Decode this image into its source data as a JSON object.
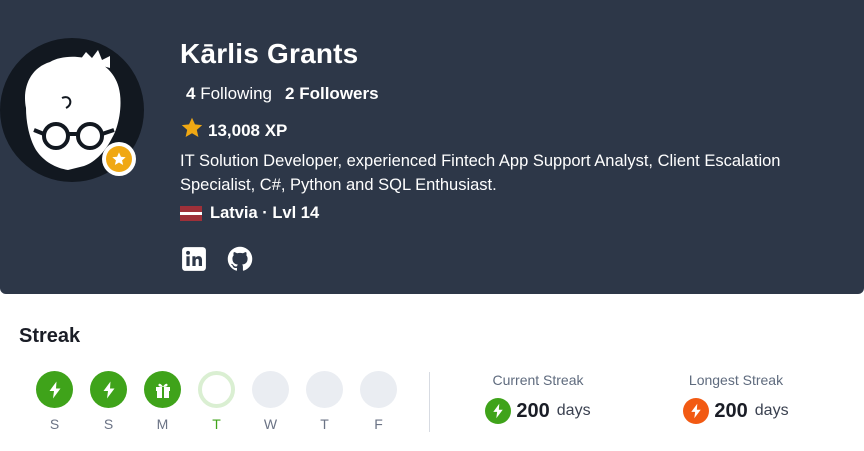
{
  "profile": {
    "name": "Kārlis Grants",
    "following_count": "4",
    "following_label": "Following",
    "followers_count": "2",
    "followers_label": "Followers",
    "xp": "13,008 XP",
    "bio": "IT Solution Developer, experienced Fintech App Support Analyst, Client Escalation Specialist, C#, Python and SQL Enthusiast.",
    "location": "Latvia · Lvl 14",
    "socials": [
      "linkedin-icon",
      "github-icon"
    ]
  },
  "streak": {
    "title": "Streak",
    "days": [
      {
        "label": "S",
        "state": "done",
        "icon": "bolt-icon"
      },
      {
        "label": "S",
        "state": "done",
        "icon": "bolt-icon"
      },
      {
        "label": "M",
        "state": "done",
        "icon": "gift-icon"
      },
      {
        "label": "T",
        "state": "today",
        "icon": ""
      },
      {
        "label": "W",
        "state": "future",
        "icon": ""
      },
      {
        "label": "T",
        "state": "future",
        "icon": ""
      },
      {
        "label": "F",
        "state": "future",
        "icon": ""
      }
    ],
    "current_label": "Current Streak",
    "current_value": "200",
    "current_unit": "days",
    "longest_label": "Longest Streak",
    "longest_value": "200",
    "longest_unit": "days"
  },
  "colors": {
    "header_bg": "#2d3748",
    "streak_green": "#3fa31a",
    "streak_orange": "#f25a13",
    "xp_gold": "#f0a813"
  }
}
